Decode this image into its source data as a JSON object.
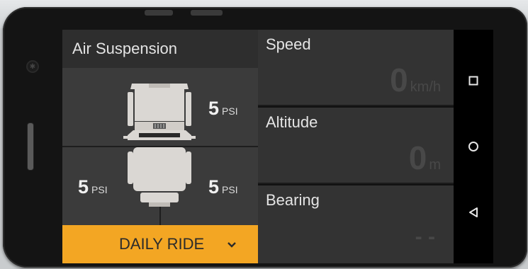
{
  "air_suspension": {
    "title": "Air Suspension",
    "front_right": {
      "value": "5",
      "unit": "PSI"
    },
    "rear_left": {
      "value": "5",
      "unit": "PSI"
    },
    "rear_right": {
      "value": "5",
      "unit": "PSI"
    }
  },
  "mode": {
    "label": "DAILY RIDE"
  },
  "speed": {
    "label": "Speed",
    "value": "0",
    "unit": "km/h"
  },
  "altitude": {
    "label": "Altitude",
    "value": "0",
    "unit": "m"
  },
  "bearing": {
    "label": "Bearing",
    "value": "- -"
  },
  "nav_bar": {
    "recents": "square-icon",
    "home": "circle-icon",
    "back": "triangle-back-icon"
  },
  "colors": {
    "accent": "#f3a623",
    "panel": "#2e2e2e",
    "tile": "#333333"
  }
}
